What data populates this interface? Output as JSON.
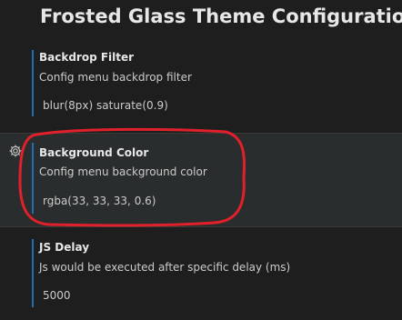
{
  "page": {
    "title": "Frosted Glass Theme Configuration"
  },
  "settings": [
    {
      "name": "Backdrop Filter",
      "description": "Config menu backdrop filter",
      "value": "blur(8px) saturate(0.9)"
    },
    {
      "name": "Background Color",
      "description": "Config menu background color",
      "value": "rgba(33, 33, 33, 0.6)"
    },
    {
      "name": "JS Delay",
      "description": "Js would be executed after specific delay (ms)",
      "value": "5000"
    }
  ],
  "icons": {
    "manage": "gear-icon"
  },
  "colors": {
    "background": "#1e1e1e",
    "hover_row": "#2a2d2e",
    "accent_bar": "#1f6fb8",
    "annotation": "#e0202a"
  }
}
